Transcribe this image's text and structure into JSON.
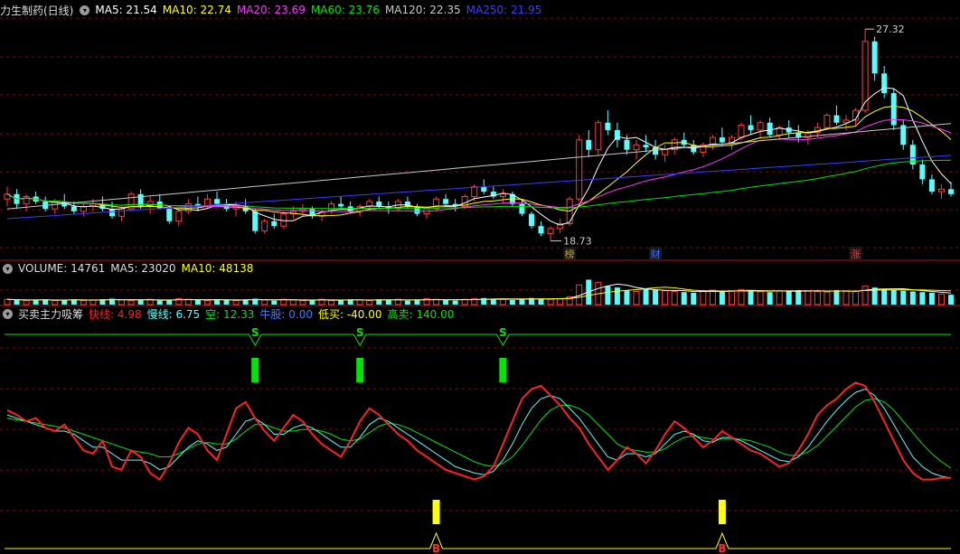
{
  "colors": {
    "background": "#000000",
    "grid": "#8b0000",
    "up": "#ff3c3c",
    "down": "#54ffff",
    "ma5": "#ffffff",
    "ma10": "#ffff00",
    "ma20": "#ff33ff",
    "ma60": "#00e600",
    "ma120": "#c8c8c8",
    "ma250": "#3c3cff",
    "fast": "#ff2020",
    "slow": "#54ffff",
    "empty": "#00e600",
    "low_buy": "#ffff00",
    "high_sell": "#00e600"
  },
  "panel_price": {
    "title": "力生制药(日线)",
    "ma": [
      {
        "label": "MA5:",
        "value": "21.54",
        "color": "#ffffff"
      },
      {
        "label": "MA10:",
        "value": "22.74",
        "color": "#ffff00"
      },
      {
        "label": "MA20:",
        "value": "23.69",
        "color": "#ff33ff"
      },
      {
        "label": "MA60:",
        "value": "23.76",
        "color": "#00e600"
      },
      {
        "label": "MA120:",
        "value": "22.35",
        "color": "#c8c8c8"
      },
      {
        "label": "MA250:",
        "value": "21.95",
        "color": "#3c3cff"
      }
    ],
    "high_label": "27.32",
    "low_label": "18.73",
    "markers": [
      "榜",
      "财",
      "涨"
    ]
  },
  "panel_volume": {
    "title": "VOLUME: 14761",
    "ma5": "MA5: 23020",
    "ma10": "MA10: 48138"
  },
  "panel_indicator": {
    "title": "买卖主力吸筹",
    "params": [
      {
        "text": "快线: 4.98",
        "color": "#ff2020"
      },
      {
        "text": "慢线: 6.75",
        "color": "#54ffff"
      },
      {
        "text": "空: 12.33",
        "color": "#00e600"
      },
      {
        "text": "牛股: 0.00",
        "color": "#3c7cff"
      },
      {
        "text": "低买: -40.00",
        "color": "#ffff00"
      },
      {
        "text": "高卖: 140.00",
        "color": "#00e600"
      }
    ],
    "sell_label": "S",
    "buy_label": "B"
  },
  "chart_data": {
    "type": "candlestick",
    "price_range": [
      18.73,
      27.32
    ],
    "candles": [
      [
        20.4,
        20.9,
        20.1,
        20.6
      ],
      [
        20.6,
        20.8,
        20.0,
        20.2
      ],
      [
        20.2,
        20.6,
        19.9,
        20.5
      ],
      [
        20.5,
        20.7,
        20.2,
        20.3
      ],
      [
        20.3,
        20.5,
        19.9,
        20.0
      ],
      [
        20.0,
        20.4,
        19.8,
        20.3
      ],
      [
        20.3,
        20.6,
        20.0,
        20.1
      ],
      [
        20.1,
        20.3,
        19.8,
        19.9
      ],
      [
        19.9,
        20.2,
        19.7,
        20.1
      ],
      [
        20.1,
        20.4,
        19.9,
        20.2
      ],
      [
        20.2,
        20.5,
        19.9,
        20.0
      ],
      [
        20.0,
        20.3,
        19.6,
        19.7
      ],
      [
        19.7,
        20.1,
        19.5,
        20.0
      ],
      [
        20.0,
        20.7,
        19.9,
        20.6
      ],
      [
        20.6,
        20.8,
        20.0,
        20.1
      ],
      [
        20.1,
        20.5,
        19.8,
        20.3
      ],
      [
        20.3,
        20.6,
        20.0,
        20.0
      ],
      [
        20.0,
        20.1,
        19.4,
        19.5
      ],
      [
        19.5,
        20.0,
        19.3,
        19.9
      ],
      [
        19.9,
        20.4,
        19.8,
        20.2
      ],
      [
        20.2,
        20.5,
        19.9,
        20.1
      ],
      [
        20.1,
        20.6,
        20.0,
        20.4
      ],
      [
        20.4,
        20.7,
        20.1,
        20.2
      ],
      [
        20.2,
        20.4,
        19.9,
        20.0
      ],
      [
        20.0,
        20.3,
        19.7,
        20.1
      ],
      [
        20.1,
        20.4,
        19.8,
        19.9
      ],
      [
        19.9,
        20.0,
        19.0,
        19.1
      ],
      [
        19.1,
        19.6,
        19.0,
        19.5
      ],
      [
        19.5,
        19.8,
        19.2,
        19.3
      ],
      [
        19.3,
        19.9,
        19.2,
        19.8
      ],
      [
        19.8,
        20.1,
        19.6,
        19.9
      ],
      [
        19.9,
        20.2,
        19.7,
        20.0
      ],
      [
        20.0,
        20.1,
        19.6,
        19.7
      ],
      [
        19.7,
        20.0,
        19.5,
        19.9
      ],
      [
        19.9,
        20.3,
        19.8,
        20.2
      ],
      [
        20.2,
        20.5,
        20.0,
        20.1
      ],
      [
        20.1,
        20.3,
        19.8,
        19.9
      ],
      [
        19.9,
        20.2,
        19.7,
        20.1
      ],
      [
        20.1,
        20.4,
        19.9,
        20.3
      ],
      [
        20.3,
        20.5,
        20.0,
        20.1
      ],
      [
        20.1,
        20.3,
        19.8,
        20.0
      ],
      [
        20.0,
        20.4,
        19.9,
        20.3
      ],
      [
        20.3,
        20.5,
        20.0,
        20.1
      ],
      [
        20.1,
        20.2,
        19.7,
        19.8
      ],
      [
        19.8,
        20.1,
        19.6,
        20.0
      ],
      [
        20.0,
        20.5,
        19.9,
        20.4
      ],
      [
        20.4,
        20.6,
        20.1,
        20.2
      ],
      [
        20.2,
        20.4,
        19.9,
        20.1
      ],
      [
        20.1,
        20.6,
        20.0,
        20.5
      ],
      [
        20.5,
        21.0,
        20.3,
        20.9
      ],
      [
        20.9,
        21.2,
        20.6,
        20.7
      ],
      [
        20.7,
        20.9,
        20.4,
        20.5
      ],
      [
        20.5,
        20.8,
        20.2,
        20.6
      ],
      [
        20.6,
        20.7,
        20.1,
        20.2
      ],
      [
        20.2,
        20.4,
        19.7,
        19.8
      ],
      [
        19.8,
        19.9,
        19.2,
        19.3
      ],
      [
        19.3,
        19.5,
        18.9,
        19.0
      ],
      [
        19.0,
        19.3,
        18.7,
        19.2
      ],
      [
        19.2,
        19.6,
        19.0,
        19.4
      ],
      [
        19.4,
        20.5,
        19.3,
        20.4
      ],
      [
        20.4,
        23.0,
        20.3,
        22.8
      ],
      [
        22.8,
        23.2,
        22.1,
        22.4
      ],
      [
        22.4,
        23.6,
        22.2,
        23.5
      ],
      [
        23.5,
        24.0,
        23.0,
        23.2
      ],
      [
        23.2,
        23.5,
        22.5,
        22.8
      ],
      [
        22.8,
        23.0,
        22.2,
        22.4
      ],
      [
        22.4,
        22.8,
        22.0,
        22.6
      ],
      [
        22.6,
        23.0,
        22.3,
        22.5
      ],
      [
        22.5,
        22.8,
        22.0,
        22.2
      ],
      [
        22.2,
        22.6,
        21.9,
        22.4
      ],
      [
        22.4,
        22.9,
        22.2,
        22.8
      ],
      [
        22.8,
        23.1,
        22.5,
        22.6
      ],
      [
        22.6,
        22.8,
        22.2,
        22.3
      ],
      [
        22.3,
        22.7,
        22.1,
        22.6
      ],
      [
        22.6,
        23.0,
        22.4,
        22.9
      ],
      [
        22.9,
        23.3,
        22.6,
        22.7
      ],
      [
        22.7,
        23.0,
        22.4,
        22.9
      ],
      [
        22.9,
        23.5,
        22.8,
        23.4
      ],
      [
        23.4,
        23.8,
        23.0,
        23.2
      ],
      [
        23.2,
        23.6,
        22.9,
        23.5
      ],
      [
        23.5,
        23.7,
        22.9,
        23.0
      ],
      [
        23.0,
        23.4,
        22.8,
        23.3
      ],
      [
        23.3,
        23.6,
        22.9,
        23.1
      ],
      [
        23.1,
        23.4,
        22.7,
        22.9
      ],
      [
        22.9,
        23.2,
        22.6,
        23.1
      ],
      [
        23.1,
        23.5,
        22.9,
        23.3
      ],
      [
        23.3,
        23.9,
        23.2,
        23.8
      ],
      [
        23.8,
        24.2,
        23.4,
        23.5
      ],
      [
        23.5,
        23.8,
        23.2,
        23.6
      ],
      [
        23.6,
        24.1,
        23.4,
        24.0
      ],
      [
        24.0,
        27.3,
        23.9,
        26.8
      ],
      [
        26.8,
        27.0,
        25.2,
        25.5
      ],
      [
        25.5,
        25.8,
        24.5,
        24.7
      ],
      [
        24.7,
        24.9,
        23.2,
        23.4
      ],
      [
        23.4,
        23.6,
        22.4,
        22.6
      ],
      [
        22.6,
        22.8,
        21.6,
        21.8
      ],
      [
        21.8,
        22.0,
        21.0,
        21.2
      ],
      [
        21.2,
        21.4,
        20.6,
        20.7
      ],
      [
        20.7,
        21.0,
        20.4,
        20.8
      ],
      [
        20.8,
        21.1,
        20.5,
        20.6
      ]
    ],
    "volume": [
      8,
      7,
      6,
      7,
      8,
      6,
      7,
      8,
      6,
      7,
      8,
      9,
      7,
      6,
      7,
      8,
      6,
      7,
      9,
      8,
      7,
      6,
      8,
      7,
      6,
      8,
      9,
      7,
      6,
      8,
      7,
      6,
      7,
      8,
      6,
      7,
      8,
      7,
      6,
      8,
      7,
      8,
      6,
      7,
      9,
      8,
      7,
      6,
      8,
      9,
      10,
      9,
      8,
      7,
      9,
      10,
      9,
      8,
      9,
      12,
      30,
      38,
      34,
      28,
      26,
      22,
      20,
      24,
      22,
      21,
      20,
      19,
      18,
      21,
      22,
      20,
      21,
      23,
      22,
      20,
      19,
      21,
      20,
      22,
      21,
      20,
      19,
      22,
      21,
      20,
      28,
      26,
      24,
      22,
      21,
      20,
      19,
      18,
      16,
      15
    ],
    "indicator_fast": [
      55,
      52,
      48,
      50,
      44,
      42,
      46,
      38,
      30,
      28,
      36,
      20,
      18,
      30,
      26,
      16,
      12,
      22,
      35,
      44,
      40,
      30,
      24,
      40,
      56,
      60,
      50,
      42,
      36,
      44,
      52,
      48,
      40,
      34,
      30,
      26,
      36,
      48,
      56,
      52,
      46,
      40,
      36,
      30,
      26,
      22,
      18,
      16,
      14,
      12,
      14,
      20,
      34,
      48,
      62,
      68,
      70,
      64,
      58,
      50,
      44,
      34,
      26,
      18,
      24,
      32,
      28,
      22,
      30,
      40,
      48,
      44,
      38,
      32,
      36,
      42,
      38,
      34,
      30,
      28,
      24,
      20,
      22,
      30,
      40,
      52,
      58,
      62,
      68,
      72,
      70,
      60,
      48,
      36,
      24,
      16,
      12,
      12,
      13,
      13
    ],
    "indicator_slow": [
      52,
      50,
      48,
      46,
      44,
      42,
      42,
      40,
      36,
      32,
      32,
      28,
      24,
      24,
      24,
      22,
      18,
      20,
      26,
      32,
      36,
      34,
      30,
      32,
      40,
      48,
      50,
      46,
      40,
      40,
      44,
      46,
      44,
      40,
      36,
      32,
      32,
      38,
      46,
      50,
      48,
      44,
      40,
      36,
      32,
      28,
      24,
      20,
      18,
      16,
      15,
      17,
      24,
      34,
      46,
      56,
      62,
      64,
      62,
      56,
      50,
      42,
      34,
      26,
      24,
      28,
      28,
      26,
      28,
      34,
      40,
      42,
      40,
      36,
      35,
      38,
      38,
      36,
      33,
      30,
      27,
      24,
      23,
      26,
      32,
      40,
      48,
      55,
      61,
      66,
      68,
      64,
      56,
      46,
      36,
      26,
      20,
      16,
      14,
      13
    ],
    "indicator_slow2": [
      50,
      49,
      48,
      47,
      46,
      45,
      44,
      42,
      40,
      38,
      36,
      34,
      32,
      30,
      29,
      28,
      26,
      26,
      28,
      31,
      34,
      35,
      34,
      34,
      37,
      42,
      46,
      46,
      44,
      42,
      42,
      43,
      43,
      42,
      40,
      37,
      36,
      37,
      41,
      45,
      47,
      46,
      44,
      41,
      38,
      35,
      32,
      29,
      26,
      23,
      21,
      20,
      22,
      26,
      33,
      41,
      49,
      55,
      58,
      58,
      56,
      52,
      46,
      40,
      34,
      31,
      30,
      29,
      29,
      31,
      35,
      38,
      39,
      38,
      37,
      37,
      37,
      37,
      36,
      34,
      32,
      29,
      27,
      27,
      29,
      33,
      39,
      45,
      51,
      57,
      61,
      62,
      60,
      55,
      48,
      41,
      34,
      28,
      23,
      19
    ],
    "sell_signals": [
      26,
      37,
      52
    ],
    "buy_signals": [
      45,
      75
    ]
  }
}
